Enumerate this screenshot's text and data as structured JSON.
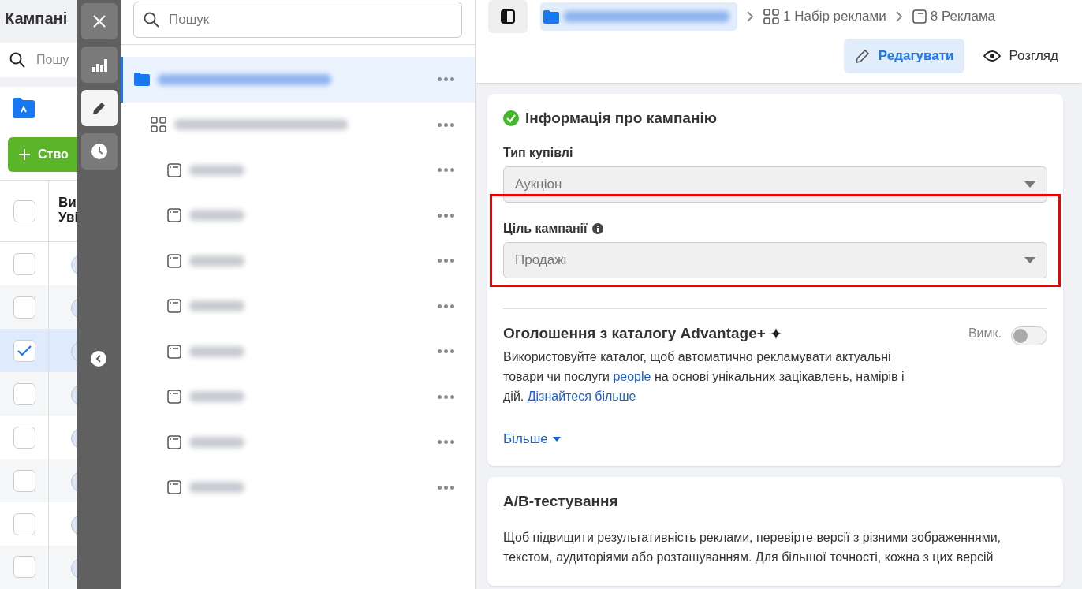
{
  "background_page": {
    "title": "Кампані",
    "search": {
      "placeholder": "Пошу"
    },
    "create_button": "Ство",
    "header": {
      "column_1": [
        "Ви",
        "Уві"
      ],
      "checked": false
    },
    "rows": [
      {
        "checked": false,
        "selected": false
      },
      {
        "checked": false,
        "selected": false
      },
      {
        "checked": true,
        "selected": true
      },
      {
        "checked": false,
        "selected": false
      },
      {
        "checked": false,
        "selected": false
      },
      {
        "checked": false,
        "selected": false
      },
      {
        "checked": false,
        "selected": false
      },
      {
        "checked": false,
        "selected": false
      }
    ]
  },
  "tool_strip": [
    {
      "kind": "close",
      "selected": false
    },
    {
      "kind": "chart",
      "selected": false
    },
    {
      "kind": "edit",
      "selected": true
    },
    {
      "kind": "history",
      "selected": false
    }
  ],
  "tree": {
    "search": {
      "placeholder": "Пошук"
    },
    "items": [
      {
        "kind": "campaign",
        "selected": true,
        "children": [
          {
            "kind": "adset",
            "selected": false,
            "children": [
              {
                "kind": "ad",
                "selected": false
              },
              {
                "kind": "ad",
                "selected": false
              },
              {
                "kind": "ad",
                "selected": false
              },
              {
                "kind": "ad",
                "selected": false
              },
              {
                "kind": "ad",
                "selected": false
              },
              {
                "kind": "ad",
                "selected": false
              },
              {
                "kind": "ad",
                "selected": false
              },
              {
                "kind": "ad",
                "selected": false
              }
            ]
          }
        ]
      }
    ]
  },
  "breadcrumb": [
    {
      "kind": "adset",
      "label": "1 Набір реклами"
    },
    {
      "kind": "ad",
      "label": "8 Реклама"
    }
  ],
  "modes": [
    {
      "kind": "edit",
      "label": "Редагувати",
      "selected": true
    },
    {
      "kind": "view",
      "label": "Розгляд",
      "selected": false
    }
  ],
  "campaign_card": {
    "title": "Інформація про кампанію",
    "complete": true,
    "fields": [
      {
        "label": "Тип купівлі",
        "value": "Аукціон",
        "info": false,
        "highlighted": false
      },
      {
        "label": "Ціль кампанії",
        "value": "Продажі",
        "info": true,
        "highlighted": true
      }
    ],
    "advantage": {
      "title": "Оголошення з каталогу Advantage+",
      "toggle_label": "Вимк.",
      "on": false,
      "text_parts": [
        "Використовуйте каталог, щоб автоматично рекламувати актуальні товари чи послуги ",
        "people",
        " на основі унікальних зацікавлень, намірів і дій. ",
        "Дізнайтеся більше"
      ]
    },
    "more": "Більше"
  },
  "ab_card": {
    "title": "A/B-тестування",
    "text": "Щоб підвищити результативність реклами, перевірте версії з різними зображеннями, текстом, аудиторіями або розташуванням. Для більшої точності, кожна з цих версій"
  }
}
